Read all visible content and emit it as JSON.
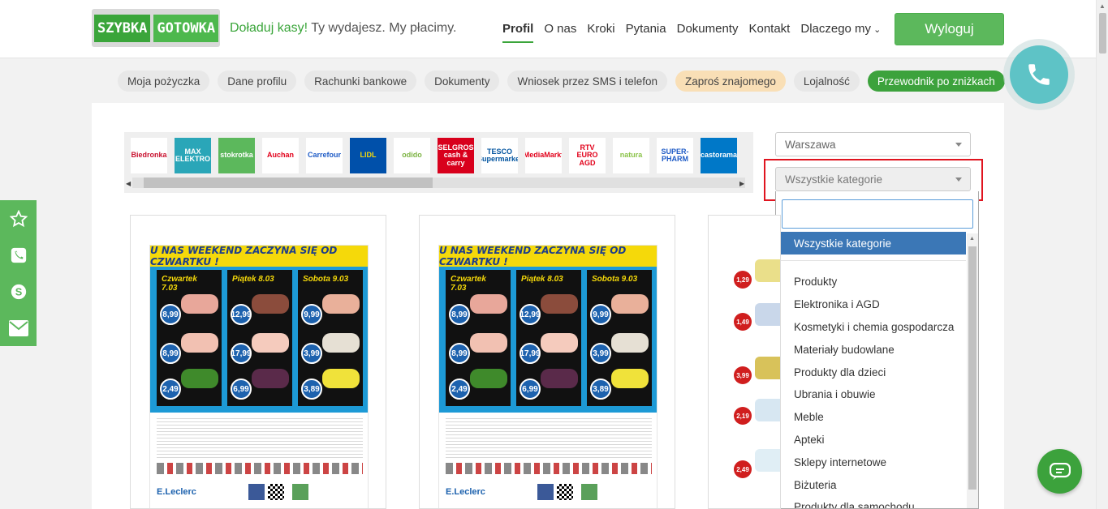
{
  "header": {
    "logo_part1": "SZYBKA",
    "logo_part2": "GOTOWKA",
    "tagline_green": "Doładuj kasy!",
    "tagline_rest": " Ty wydajesz. My płacimy.",
    "nav": [
      "Profil",
      "O nas",
      "Kroki",
      "Pytania",
      "Dokumenty",
      "Kontakt",
      "Dlaczego my"
    ],
    "logout_label": "Wyloguj"
  },
  "subnav": [
    "Moja pożyczka",
    "Dane profilu",
    "Rachunki bankowe",
    "Dokumenty",
    "Wniosek przez SMS i telefon",
    "Zaproś znajomego",
    "Lojalność",
    "Przewodnik po zniżkach"
  ],
  "shops": [
    {
      "name": "Biedronka",
      "color": "#c8102e"
    },
    {
      "name": "MAX ELEKTRO",
      "color": "#ffffff"
    },
    {
      "name": "stokrotka",
      "color": "#ffffff"
    },
    {
      "name": "Auchan",
      "color": "#e2001a"
    },
    {
      "name": "Carrefour",
      "color": "#1e5bc6"
    },
    {
      "name": "LIDL",
      "color": "#f5d90a"
    },
    {
      "name": "odido",
      "color": "#7cb342"
    },
    {
      "name": "SELGROS cash & carry",
      "color": "#ffffff"
    },
    {
      "name": "TESCO Supermarket",
      "color": "#00539f"
    },
    {
      "name": "MediaMarkt",
      "color": "#e2001a"
    },
    {
      "name": "RTV EURO AGD",
      "color": "#e2001a"
    },
    {
      "name": "natura",
      "color": "#8bc34a"
    },
    {
      "name": "SUPER-PHARM",
      "color": "#1e5bc6"
    },
    {
      "name": "castorama",
      "color": "#ffffff"
    }
  ],
  "filters": {
    "city": "Warszawa",
    "category": "Wszystkie kategorie"
  },
  "dropdown": {
    "selected": "Wszystkie kategorie",
    "items": [
      "Produkty",
      "Elektronika i AGD",
      "Kosmetyki i chemia gospodarcza",
      "Materiały budowlane",
      "Produkty dla dzieci",
      "Ubrania i obuwie",
      "Meble",
      "Apteki",
      "Sklepy internetowe",
      "Biżuteria",
      "Produkty dla samochodu"
    ]
  },
  "flyer": {
    "title": "U NAS WEEKEND ZACZYNA SIĘ OD CZWARTKU !",
    "days": [
      "Czwartek 7.03",
      "Piątek 8.03",
      "Sobota 9.03"
    ],
    "prices": [
      [
        "8,99",
        "8,99",
        "2,49"
      ],
      [
        "12,99",
        "17,99",
        "6,99"
      ],
      [
        "9,99",
        "3,99",
        "3,89"
      ]
    ],
    "brand": "E.Leclerc"
  },
  "flyer3_prices": [
    "1,29",
    "1,49",
    "3,99",
    "2,19",
    "2,49"
  ]
}
